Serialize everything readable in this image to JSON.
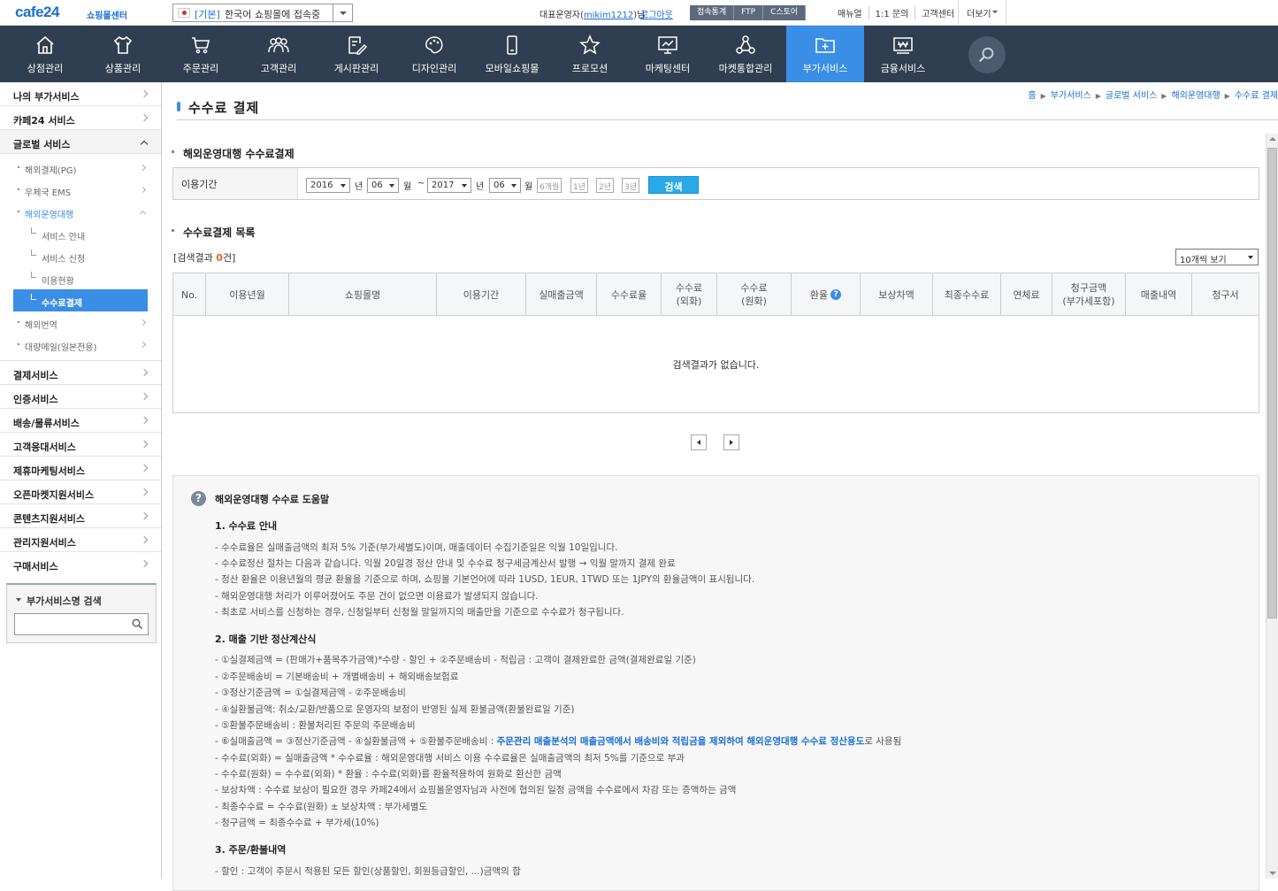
{
  "topbar": {
    "logo": "cafe24",
    "logo_sub": "쇼핑몰센터",
    "mall_tag": "[기본]",
    "mall_name": "한국어 쇼핑몰에 접속중",
    "operator_prefix": "대표운영자(",
    "operator_id": "mikim1212",
    "operator_suffix": ")님",
    "logout": "로그아웃",
    "stat_buttons": [
      "접속통계",
      "FTP",
      "C스토어"
    ],
    "links": [
      "매뉴얼",
      "1:1 문의",
      "고객센터"
    ],
    "more": "더보기"
  },
  "gnb": {
    "items": [
      {
        "label": "상점관리",
        "icon": "home-icon"
      },
      {
        "label": "상품관리",
        "icon": "shirt-icon"
      },
      {
        "label": "주문관리",
        "icon": "cart-icon"
      },
      {
        "label": "고객관리",
        "icon": "users-icon"
      },
      {
        "label": "게시판관리",
        "icon": "edit-icon"
      },
      {
        "label": "디자인관리",
        "icon": "palette-icon"
      },
      {
        "label": "모바일쇼핑몰",
        "icon": "mobile-icon"
      },
      {
        "label": "프로모션",
        "icon": "star-icon"
      },
      {
        "label": "마케팅센터",
        "icon": "monitor-icon"
      },
      {
        "label": "마켓통합관리",
        "icon": "network-icon"
      },
      {
        "label": "부가서비스",
        "icon": "folder-plus-icon"
      },
      {
        "label": "금융서비스",
        "icon": "won-card-icon"
      }
    ],
    "active_index": 10
  },
  "lnb": {
    "top": [
      "나의 부가서비스",
      "카페24 서비스"
    ],
    "global": "글로벌 서비스",
    "global_children": [
      "해외결제(PG)",
      "우체국 EMS",
      "해외운영대행"
    ],
    "agency_children": [
      "서비스 안내",
      "서비스 신청",
      "이용현황",
      "수수료결제"
    ],
    "global_rest": [
      "해외번역",
      "대량메일(일본전용)"
    ],
    "bottom": [
      "결제서비스",
      "인증서비스",
      "배송/물류서비스",
      "고객응대서비스",
      "제휴마케팅서비스",
      "오픈마켓지원서비스",
      "콘텐츠지원서비스",
      "관리지원서비스",
      "구매서비스"
    ],
    "search_title": "부가서비스명 검색",
    "search_placeholder": ""
  },
  "breadcrumb": [
    "홈",
    "부가서비스",
    "글로벌 서비스",
    "해외운영대행",
    "수수료 결제"
  ],
  "page_title": "수수료 결제",
  "filter": {
    "section_title": "해외운영대행 수수료결제",
    "label": "이용기간",
    "from_year": "2016",
    "from_month": "06",
    "to_year": "2017",
    "to_month": "06",
    "year_unit": "년",
    "month_unit": "월",
    "tilde": "~",
    "period_buttons": [
      "6개월",
      "1년",
      "2년",
      "3년"
    ],
    "search": "검색"
  },
  "list": {
    "section_title": "수수료결제 목록",
    "count_prefix": "[검색결과 ",
    "count": "0",
    "count_suffix": "건]",
    "page_size": "10개씩 보기",
    "columns": [
      "No.",
      "이용년월",
      "쇼핑몰명",
      "이용기간",
      "실매출금액",
      "수수료율",
      "수수료\n(외화)",
      "수수료\n(원화)",
      "환율",
      "보상차액",
      "최종수수료",
      "연체료",
      "청구금액\n(부가세포함)",
      "매출내역",
      "청구서"
    ],
    "empty": "검색결과가 없습니다."
  },
  "help": {
    "title": "해외운영대행 수수료 도움말",
    "s1_title": "1. 수수료 안내",
    "s1": [
      "- 수수료율은 실매출금액의 최저 5% 기준(부가세별도)이며, 매출데이터 수집기준일은 익월 10일입니다.",
      "- 수수료정산 절차는 다음과 같습니다. 익월 20일경 정산 안내 및 수수료 청구세금계산서 발행 → 익월 말까지 결제 완료",
      "- 정산 환율은 이용년월의 평균 환율을 기준으로 하며, 쇼핑몰 기본언어에 따라 1USD, 1EUR, 1TWD 또는 1JPY의 환율금액이 표시됩니다.",
      "- 해외운영대행 처리가 이루어졌어도 주문 건이 없으면 이용료가 발생되지 않습니다.",
      "- 최초로 서비스를 신청하는 경우, 신청일부터 신청월 말일까지의 매출만을 기준으로 수수료가 청구됩니다."
    ],
    "s2_title": "2. 매출 기반 정산계산식",
    "s2": [
      "- ①실결제금액 = (판매가+품목추가금액)*수량 - 할인 + ②주문배송비 - 적립금 : 고객이 결제완료한 금액(결제완료일 기준)",
      "- ②주문배송비 = 기본배송비 + 개별배송비 + 해외배송보험료",
      "- ③정산기준금액 = ①실결제금액 - ②주문배송비",
      "- ④실환불금액: 취소/교환/반품으로 운영자의 보정이 반영된 실제 환불금액(환불완료일 기준)",
      "- ⑤환불주문배송비 : 환불처리된 주문의 주문배송비"
    ],
    "s2_6_pre": "- ⑥실매출금액 = ③정산기준금액 - ④실환불금액 + ⑤환불주문배송비 : ",
    "s2_6_blue": "주문관리 매출분석의 매출금액에서 배송비와 적립금을 제외하여 해외운영대행 수수료 정산용도",
    "s2_6_post": "로 사용됨",
    "s2b": [
      "- 수수료(외화) = 실매출금액 * 수수료율 : 해외운영대행 서비스 이용 수수료율은 실매출금액의 최저 5%를 기준으로 부과",
      "- 수수료(원화) = 수수료(외화) * 환율 : 수수료(외화)를 환율적용하여 원화로 환산한 금액",
      "- 보상차액 : 수수료 보상이 필요한 경우 카페24에서 쇼핑몰운영자님과 사전에 협의된 일정 금액을 수수료에서 차감 또는 증액하는 금액",
      "- 최종수수료 = 수수료(원화) ± 보상차액 : 부가세별도",
      "- 청구금액 = 최종수수료 + 부가세(10%)"
    ],
    "s3_title": "3. 주문/환불내역",
    "s3": [
      "- 할인 : 고객이 주문시 적용된 모든 할인(상품할인, 회원등급할인, ...)금액의 합"
    ]
  }
}
